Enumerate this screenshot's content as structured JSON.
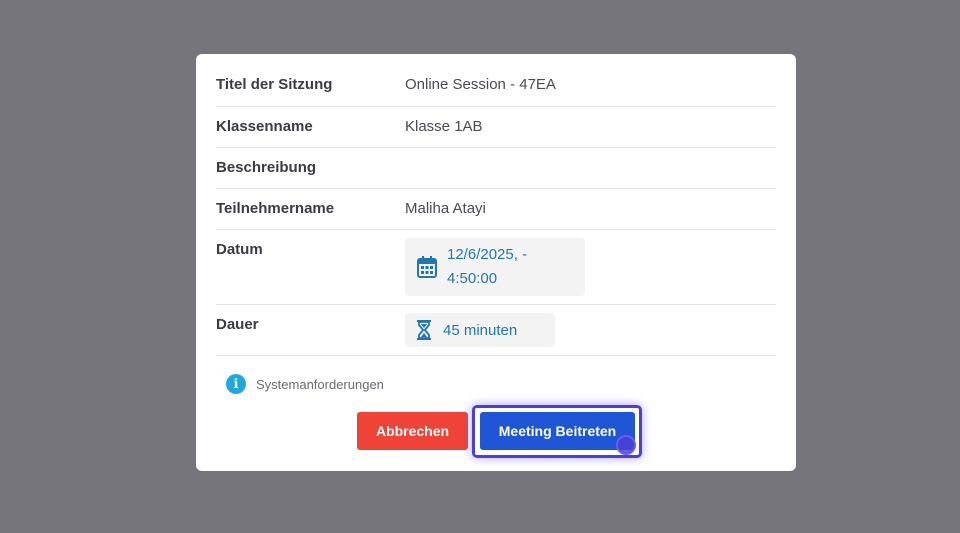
{
  "details": {
    "title_label": "Titel der Sitzung",
    "title_value": "Online Session - 47EA",
    "class_label": "Klassenname",
    "class_value": "Klasse 1AB",
    "description_label": "Beschreibung",
    "description_value": "",
    "participant_label": "Teilnehmername",
    "participant_value": "Maliha Atayi",
    "date_label": "Datum",
    "date_line1": "12/6/2025, -",
    "date_line2": "4:50:00",
    "duration_label": "Dauer",
    "duration_value": "45 minuten"
  },
  "system_requirements": {
    "label": "Systemanforderungen",
    "icon": "info-icon"
  },
  "buttons": {
    "cancel_label": "Abbrechen",
    "join_label": "Meeting Beitreten"
  },
  "colors": {
    "overlay": "#77757c",
    "cancel": "#ee4336",
    "join": "#1f56d6",
    "accent_text": "#1f76b5",
    "info": "#1ea7e1",
    "focus_ring": "#4b3fd8"
  }
}
